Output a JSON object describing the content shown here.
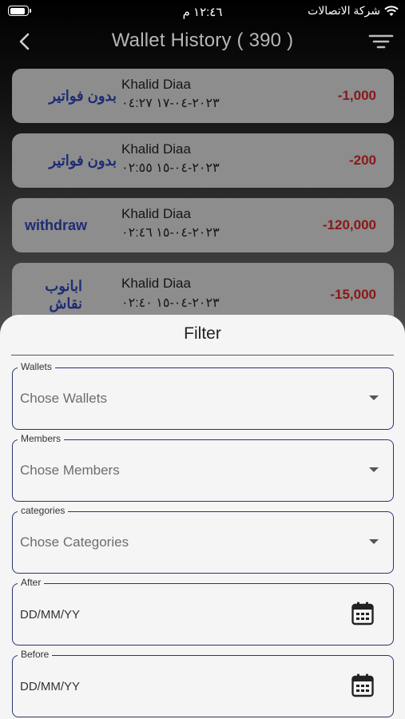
{
  "status_bar": {
    "time": "١٢:٤٦ م",
    "carrier": "شركة الاتصالات"
  },
  "app_bar": {
    "title": "Wallet History ( 390 )"
  },
  "transactions": [
    {
      "category": "بدون فواتير",
      "name": "Khalid Diaa",
      "date": "٢٠٢٣-٠٤-١٧ ٠٤:٢٧",
      "amount": "-1,000"
    },
    {
      "category": "بدون فواتير",
      "name": "Khalid Diaa",
      "date": "٢٠٢٣-٠٤-١٥ ٠٢:٥٥",
      "amount": "-200"
    },
    {
      "category": "withdraw",
      "name": "Khalid Diaa",
      "date": "٢٠٢٣-٠٤-١٥ ٠٢:٤٦",
      "amount": "-120,000"
    },
    {
      "category": "ابانوب نقاش",
      "name": "Khalid Diaa",
      "date": "٢٠٢٣-٠٤-١٥ ٠٢:٤٠",
      "amount": "-15,000"
    }
  ],
  "filter": {
    "title": "Filter",
    "wallets": {
      "label": "Wallets",
      "placeholder": "Chose Wallets"
    },
    "members": {
      "label": "Members",
      "placeholder": "Chose Members"
    },
    "categories": {
      "label": "categories",
      "placeholder": "Chose Categories"
    },
    "after": {
      "label": "After",
      "placeholder": "DD/MM/YY"
    },
    "before": {
      "label": "Before",
      "placeholder": "DD/MM/YY"
    }
  },
  "colors": {
    "accent": "#2a3474",
    "amount": "#8a1818",
    "category": "#1d2c74"
  }
}
